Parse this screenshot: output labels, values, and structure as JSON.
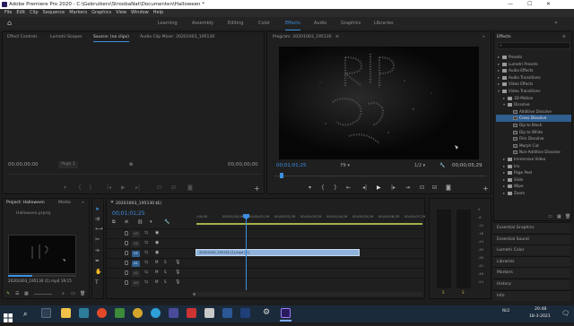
{
  "app": {
    "title": "Adobe Premiere Pro 2020 - C:\\Gebruikers\\StroobaNat\\Documenten\\Halloween *",
    "min_icon": "minimize-icon",
    "max_icon": "maximize-icon",
    "close_icon": "close-icon"
  },
  "menu": [
    "File",
    "Edit",
    "Clip",
    "Sequence",
    "Markers",
    "Graphics",
    "View",
    "Window",
    "Help"
  ],
  "workspaces": {
    "home_icon": "home-icon",
    "tabs": [
      "Learning",
      "Assembly",
      "Editing",
      "Color",
      "Effects",
      "Audio",
      "Graphics",
      "Libraries"
    ],
    "active": "Effects",
    "more": "»"
  },
  "source_panel": {
    "tabs": [
      "Effect Controls",
      "Lumetri Scopes",
      "Source: (no clips)",
      "Audio Clip Mixer: 20201003_195130"
    ],
    "active": "Source: (no clips)",
    "timecode_left": "00;00;00;00",
    "timecode_right": "00;00;00;00",
    "page": "Page 1"
  },
  "program_panel": {
    "title": "Program: 20201003_195130",
    "timecode": "00;01;01;25",
    "fit": "Fit",
    "resolution": "1/2",
    "duration": "00;00;05;29"
  },
  "effects_panel": {
    "title": "Effects",
    "items": [
      {
        "label": "Presets",
        "indent": 0,
        "type": "folder"
      },
      {
        "label": "Lumetri Presets",
        "indent": 0,
        "type": "folder"
      },
      {
        "label": "Audio Effects",
        "indent": 0,
        "type": "folder"
      },
      {
        "label": "Audio Transitions",
        "indent": 0,
        "type": "folder"
      },
      {
        "label": "Video Effects",
        "indent": 0,
        "type": "folder"
      },
      {
        "label": "Video Transitions",
        "indent": 0,
        "type": "folder-open"
      },
      {
        "label": "3D Motion",
        "indent": 1,
        "type": "folder"
      },
      {
        "label": "Dissolve",
        "indent": 1,
        "type": "folder-open"
      },
      {
        "label": "Additive Dissolve",
        "indent": 2,
        "type": "effect"
      },
      {
        "label": "Cross Dissolve",
        "indent": 2,
        "type": "effect",
        "selected": true
      },
      {
        "label": "Dip to Black",
        "indent": 2,
        "type": "effect"
      },
      {
        "label": "Dip to White",
        "indent": 2,
        "type": "effect"
      },
      {
        "label": "Film Dissolve",
        "indent": 2,
        "type": "effect"
      },
      {
        "label": "Morph Cut",
        "indent": 2,
        "type": "effect"
      },
      {
        "label": "Non-Additive Dissolve",
        "indent": 2,
        "type": "effect"
      },
      {
        "label": "Immersive Video",
        "indent": 1,
        "type": "folder"
      },
      {
        "label": "Iris",
        "indent": 1,
        "type": "folder"
      },
      {
        "label": "Page Peel",
        "indent": 1,
        "type": "folder"
      },
      {
        "label": "Slide",
        "indent": 1,
        "type": "folder"
      },
      {
        "label": "Wipe",
        "indent": 1,
        "type": "folder"
      },
      {
        "label": "Zoom",
        "indent": 1,
        "type": "folder"
      }
    ]
  },
  "right_panels": [
    "Essential Graphics",
    "Essential Sound",
    "Lumetri Color",
    "Libraries",
    "Markers",
    "History",
    "Info"
  ],
  "project_panel": {
    "tabs": [
      "Project: Halloween",
      "Media"
    ],
    "more": "»",
    "file": "Halloween.prproj",
    "clip_name": "20201003_195130 (1).mp4",
    "clip_duration": "19;15"
  },
  "timeline": {
    "title": "20201003_195130 (1)",
    "timecode": "00;01;01;25",
    "ruler": [
      ";00;00",
      "00;00;00;29",
      "00;00;01;29",
      "00;00;02;29",
      "00;00;03;29",
      "00;00;04;29",
      "00;00;05;29",
      "00;00;06;29",
      "00;00;07;29"
    ],
    "tracks": [
      {
        "name": "V3",
        "type": "video"
      },
      {
        "name": "V2",
        "type": "video"
      },
      {
        "name": "V1",
        "type": "video"
      },
      {
        "name": "A1",
        "type": "audio"
      },
      {
        "name": "A2",
        "type": "audio"
      },
      {
        "name": "A3",
        "type": "audio"
      }
    ],
    "clip_label": "20201003_195130 (1).mp4 [V]",
    "track_buttons": [
      "M",
      "S"
    ]
  },
  "audio_meter": {
    "labels": [
      "0",
      "-6",
      "-12",
      "-18",
      "-24",
      "-30",
      "-36",
      "-42",
      "-48",
      "-54"
    ],
    "footer": [
      "S",
      "S"
    ]
  },
  "taskbar": {
    "time": "20:48",
    "date": "18-3-2021",
    "lang": "NLD"
  },
  "colors": {
    "accent": "#3d8fe0",
    "selection": "#2f5e8f",
    "clip": "#8fb3dc",
    "playhead": "#3d8fe0"
  }
}
